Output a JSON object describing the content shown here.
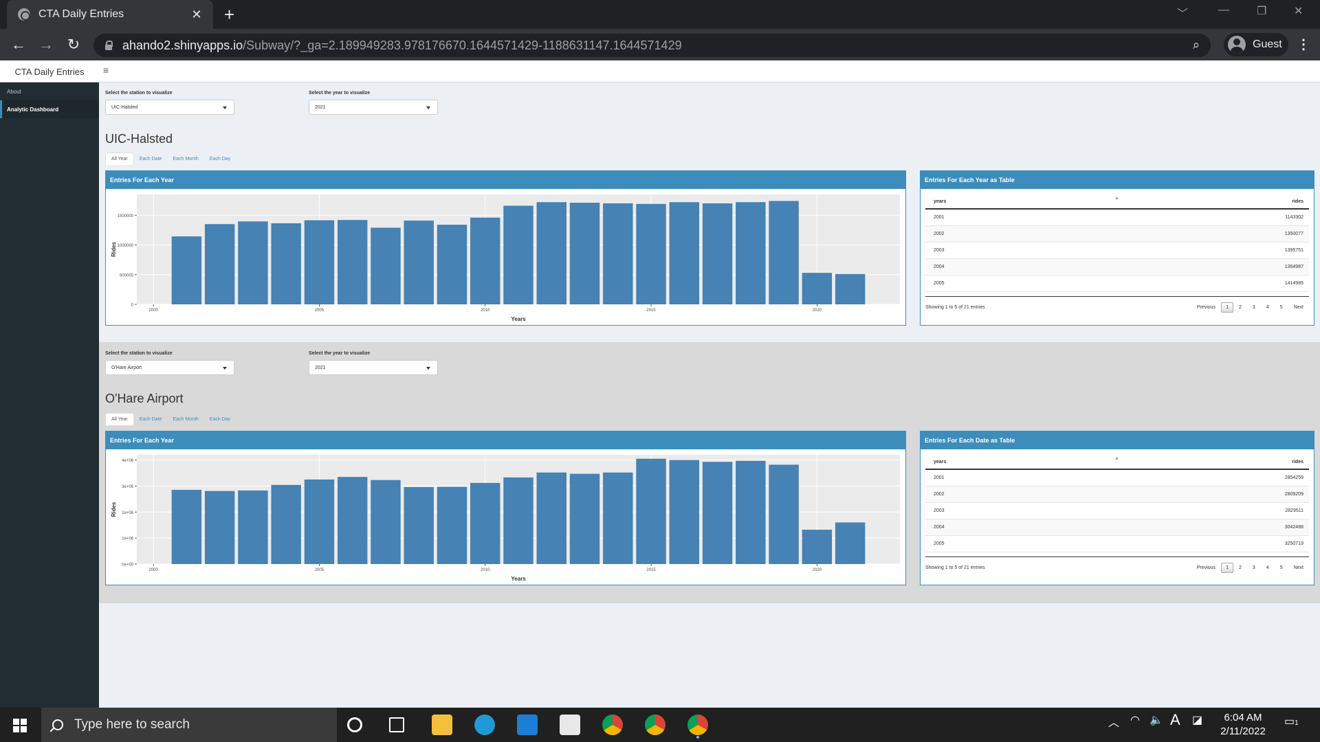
{
  "browser": {
    "tab_title": "CTA Daily Entries",
    "tab_close": "✕",
    "new_tab": "+",
    "url_host": "ahando2.shinyapps.io",
    "url_path": "/Subway/?_ga=2.189949283.978176670.1644571429-1188631147.1644571429",
    "profile": "Guest"
  },
  "app": {
    "brand": "CTA Daily Entries",
    "menu_icon": "≡",
    "sidebar": [
      {
        "label": "About"
      },
      {
        "label": "Analytic Dashboard"
      }
    ]
  },
  "panels": [
    {
      "station_label": "Select the station to visualize",
      "station_value": "UIC-Halsted",
      "year_label": "Select the year to visualize",
      "year_value": "2021",
      "title": "UIC-Halsted",
      "tabs": [
        "All Year",
        "Each Date",
        "Each Month",
        "Each Day"
      ],
      "chart_title": "Entries For Each Year",
      "table_title": "Entries For Each Year as Table",
      "table": {
        "headers": [
          "years",
          "rides"
        ],
        "sort_glyph": "▲",
        "rows": [
          [
            "2001",
            "1143302"
          ],
          [
            "2002",
            "1350077"
          ],
          [
            "2003",
            "1395751"
          ],
          [
            "2004",
            "1364987"
          ],
          [
            "2005",
            "1414985"
          ]
        ],
        "info": "Showing 1 to 5 of 21 entries",
        "pager": [
          "Previous",
          "1",
          "2",
          "3",
          "4",
          "5",
          "Next"
        ]
      }
    },
    {
      "station_label": "Select the station to visualize",
      "station_value": "O'Hare Airport",
      "year_label": "Select the year to visualize",
      "year_value": "2021",
      "title": "O'Hare Airport",
      "tabs": [
        "All Year",
        "Each Date",
        "Each Month",
        "Each Day"
      ],
      "chart_title": "Entries For Each Year",
      "table_title": "Entries For Each Date as Table",
      "table": {
        "headers": [
          "years",
          "rides"
        ],
        "sort_glyph": "▲",
        "rows": [
          [
            "2001",
            "2854259"
          ],
          [
            "2002",
            "2809209"
          ],
          [
            "2003",
            "2829511"
          ],
          [
            "2004",
            "3042488"
          ],
          [
            "2005",
            "3250719"
          ]
        ],
        "info": "Showing 1 to 5 of 21 entries",
        "pager": [
          "Previous",
          "1",
          "2",
          "3",
          "4",
          "5",
          "Next"
        ]
      }
    }
  ],
  "chart_data": [
    {
      "type": "bar",
      "x": [
        2001,
        2002,
        2003,
        2004,
        2005,
        2006,
        2007,
        2008,
        2009,
        2010,
        2011,
        2012,
        2013,
        2014,
        2015,
        2016,
        2017,
        2018,
        2019,
        2020,
        2021
      ],
      "values": [
        1143302,
        1350077,
        1395751,
        1364987,
        1414985,
        1420000,
        1290000,
        1410000,
        1340000,
        1460000,
        1660000,
        1720000,
        1710000,
        1700000,
        1690000,
        1720000,
        1700000,
        1720000,
        1740000,
        530000,
        510000
      ],
      "xlabel": "Years",
      "ylabel": "Rides",
      "xticks": [
        2000,
        2005,
        2010,
        2015,
        2020
      ],
      "yticks": [
        0,
        500000,
        1000000,
        1500000
      ],
      "ytick_labels": [
        "0",
        "500000",
        "1000000",
        "1500000"
      ],
      "ylim": [
        0,
        1850000
      ],
      "xlim": [
        1999.5,
        2022.5
      ],
      "color": "#4682b4"
    },
    {
      "type": "bar",
      "x": [
        2001,
        2002,
        2003,
        2004,
        2005,
        2006,
        2007,
        2008,
        2009,
        2010,
        2011,
        2012,
        2013,
        2014,
        2015,
        2016,
        2017,
        2018,
        2019,
        2020,
        2021
      ],
      "values": [
        2854259,
        2809209,
        2829511,
        3042488,
        3250719,
        3350000,
        3230000,
        2960000,
        2970000,
        3120000,
        3330000,
        3520000,
        3470000,
        3520000,
        4050000,
        4000000,
        3930000,
        3970000,
        3820000,
        1320000,
        1600000
      ],
      "xlabel": "Years",
      "ylabel": "Rides",
      "xticks": [
        2000,
        2005,
        2010,
        2015,
        2020
      ],
      "yticks": [
        0,
        1000000,
        2000000,
        3000000,
        4000000
      ],
      "ytick_labels": [
        "0e+00",
        "1e+06",
        "2e+06",
        "3e+06",
        "4e+06"
      ],
      "ylim": [
        0,
        4200000
      ],
      "xlim": [
        1999.5,
        2022.5
      ],
      "color": "#4682b4"
    }
  ],
  "taskbar": {
    "search_placeholder": "Type here to search",
    "time": "6:04 AM",
    "date": "2/11/2022",
    "notif_count": "1"
  }
}
